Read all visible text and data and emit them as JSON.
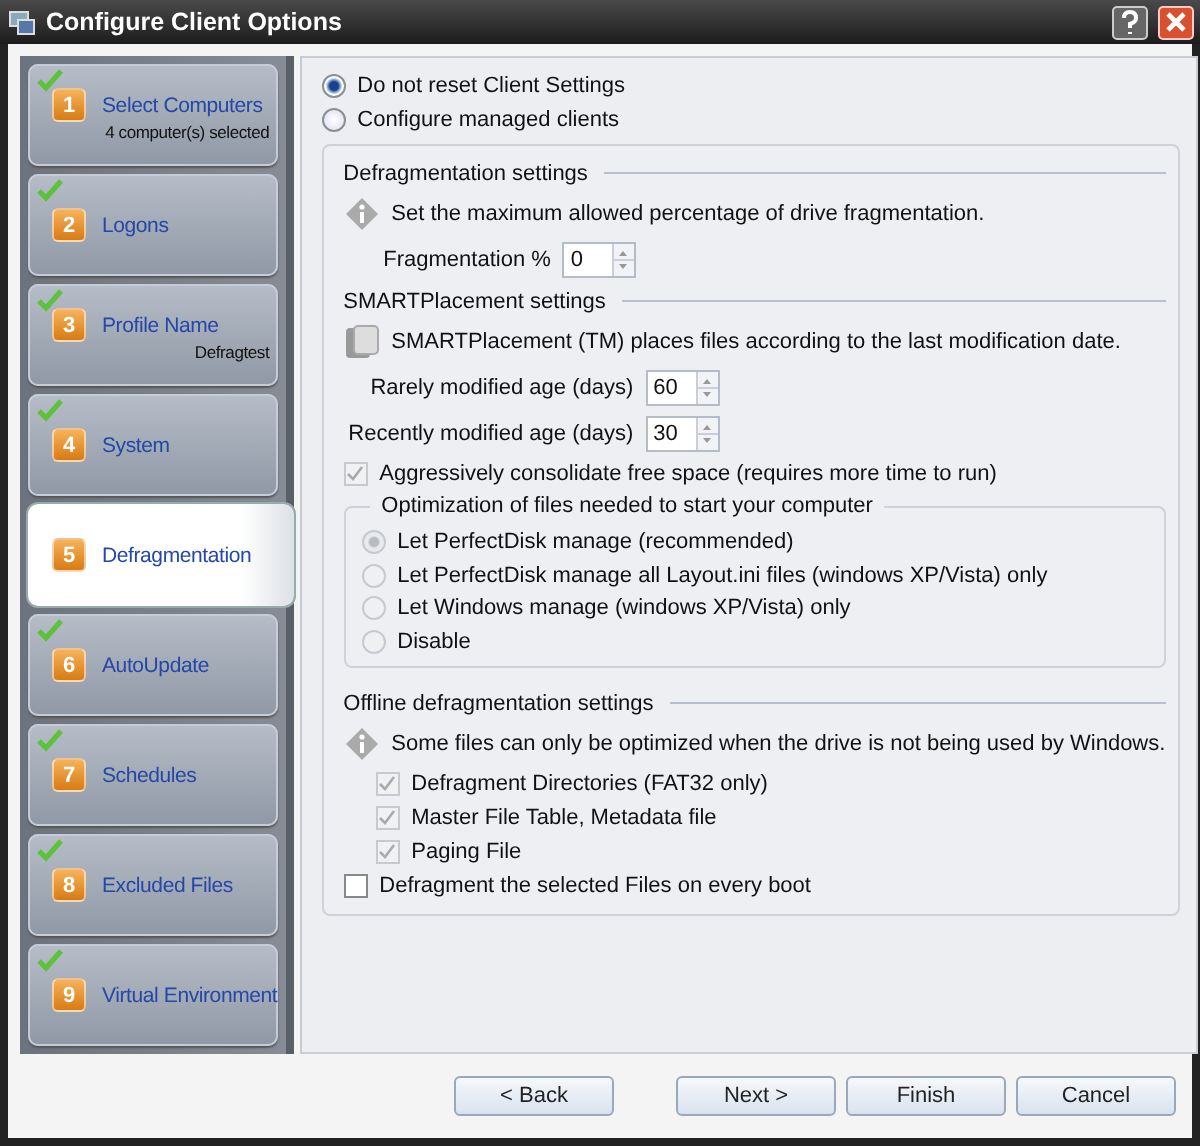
{
  "window": {
    "title": "Configure Client Options"
  },
  "steps": [
    {
      "number": "1",
      "label": "Select Computers",
      "detail": "4 computer(s) selected",
      "done": true,
      "selected": false
    },
    {
      "number": "2",
      "label": "Logons",
      "done": true,
      "selected": false
    },
    {
      "number": "3",
      "label": "Profile Name",
      "detail": "Defragtest",
      "done": true,
      "selected": false
    },
    {
      "number": "4",
      "label": "System",
      "done": true,
      "selected": false
    },
    {
      "number": "5",
      "label": "Defragmentation",
      "done": false,
      "selected": true
    },
    {
      "number": "6",
      "label": "AutoUpdate",
      "done": true,
      "selected": false
    },
    {
      "number": "7",
      "label": "Schedules",
      "done": true,
      "selected": false
    },
    {
      "number": "8",
      "label": "Excluded Files",
      "done": true,
      "selected": false
    },
    {
      "number": "9",
      "label": "Virtual Environment",
      "done": true,
      "selected": false
    }
  ],
  "reset_options": [
    {
      "label": "Do not reset Client Settings",
      "selected": true
    },
    {
      "label": "Configure managed clients",
      "selected": false
    }
  ],
  "defragmentation": {
    "heading": "Defragmentation settings",
    "info": "Set the maximum allowed percentage of drive fragmentation.",
    "field": {
      "label": "Fragmentation %",
      "value": "0"
    }
  },
  "smart_placement": {
    "heading": "SMARTPlacement settings",
    "info": "SMARTPlacement (TM) places files according to the last modification date.",
    "fields": [
      {
        "label": "Rarely modified age (days)",
        "value": "60"
      },
      {
        "label": "Recently modified age (days)",
        "value": "30"
      }
    ],
    "consolidate": {
      "label": "Aggressively consolidate free space (requires more time to run)",
      "checked": true,
      "disabled": true
    }
  },
  "optimization": {
    "heading": "Optimization of files needed to start your computer",
    "options": [
      {
        "label": "Let PerfectDisk manage (recommended)",
        "selected": true,
        "disabled": true
      },
      {
        "label": "Let PerfectDisk manage all Layout.ini files (windows XP/Vista) only",
        "selected": false,
        "disabled": true
      },
      {
        "label": "Let Windows manage (windows XP/Vista) only",
        "selected": false,
        "disabled": true
      },
      {
        "label": "Disable",
        "selected": false,
        "disabled": true
      }
    ]
  },
  "offline": {
    "heading": "Offline defragmentation settings",
    "info": "Some files can only be optimized when the drive is not being used by Windows.",
    "files": [
      {
        "label": "Defragment Directories (FAT32 only)",
        "checked": true,
        "disabled": true
      },
      {
        "label": "Master File Table, Metadata file",
        "checked": true,
        "disabled": true
      },
      {
        "label": "Paging File",
        "checked": true,
        "disabled": true
      }
    ],
    "every_boot": {
      "label": "Defragment the selected Files on every boot",
      "checked": false,
      "disabled": false
    }
  },
  "buttons": [
    {
      "label": "< Back"
    },
    {
      "label": "Next >"
    },
    {
      "label": "Finish"
    },
    {
      "label": "Cancel"
    }
  ]
}
